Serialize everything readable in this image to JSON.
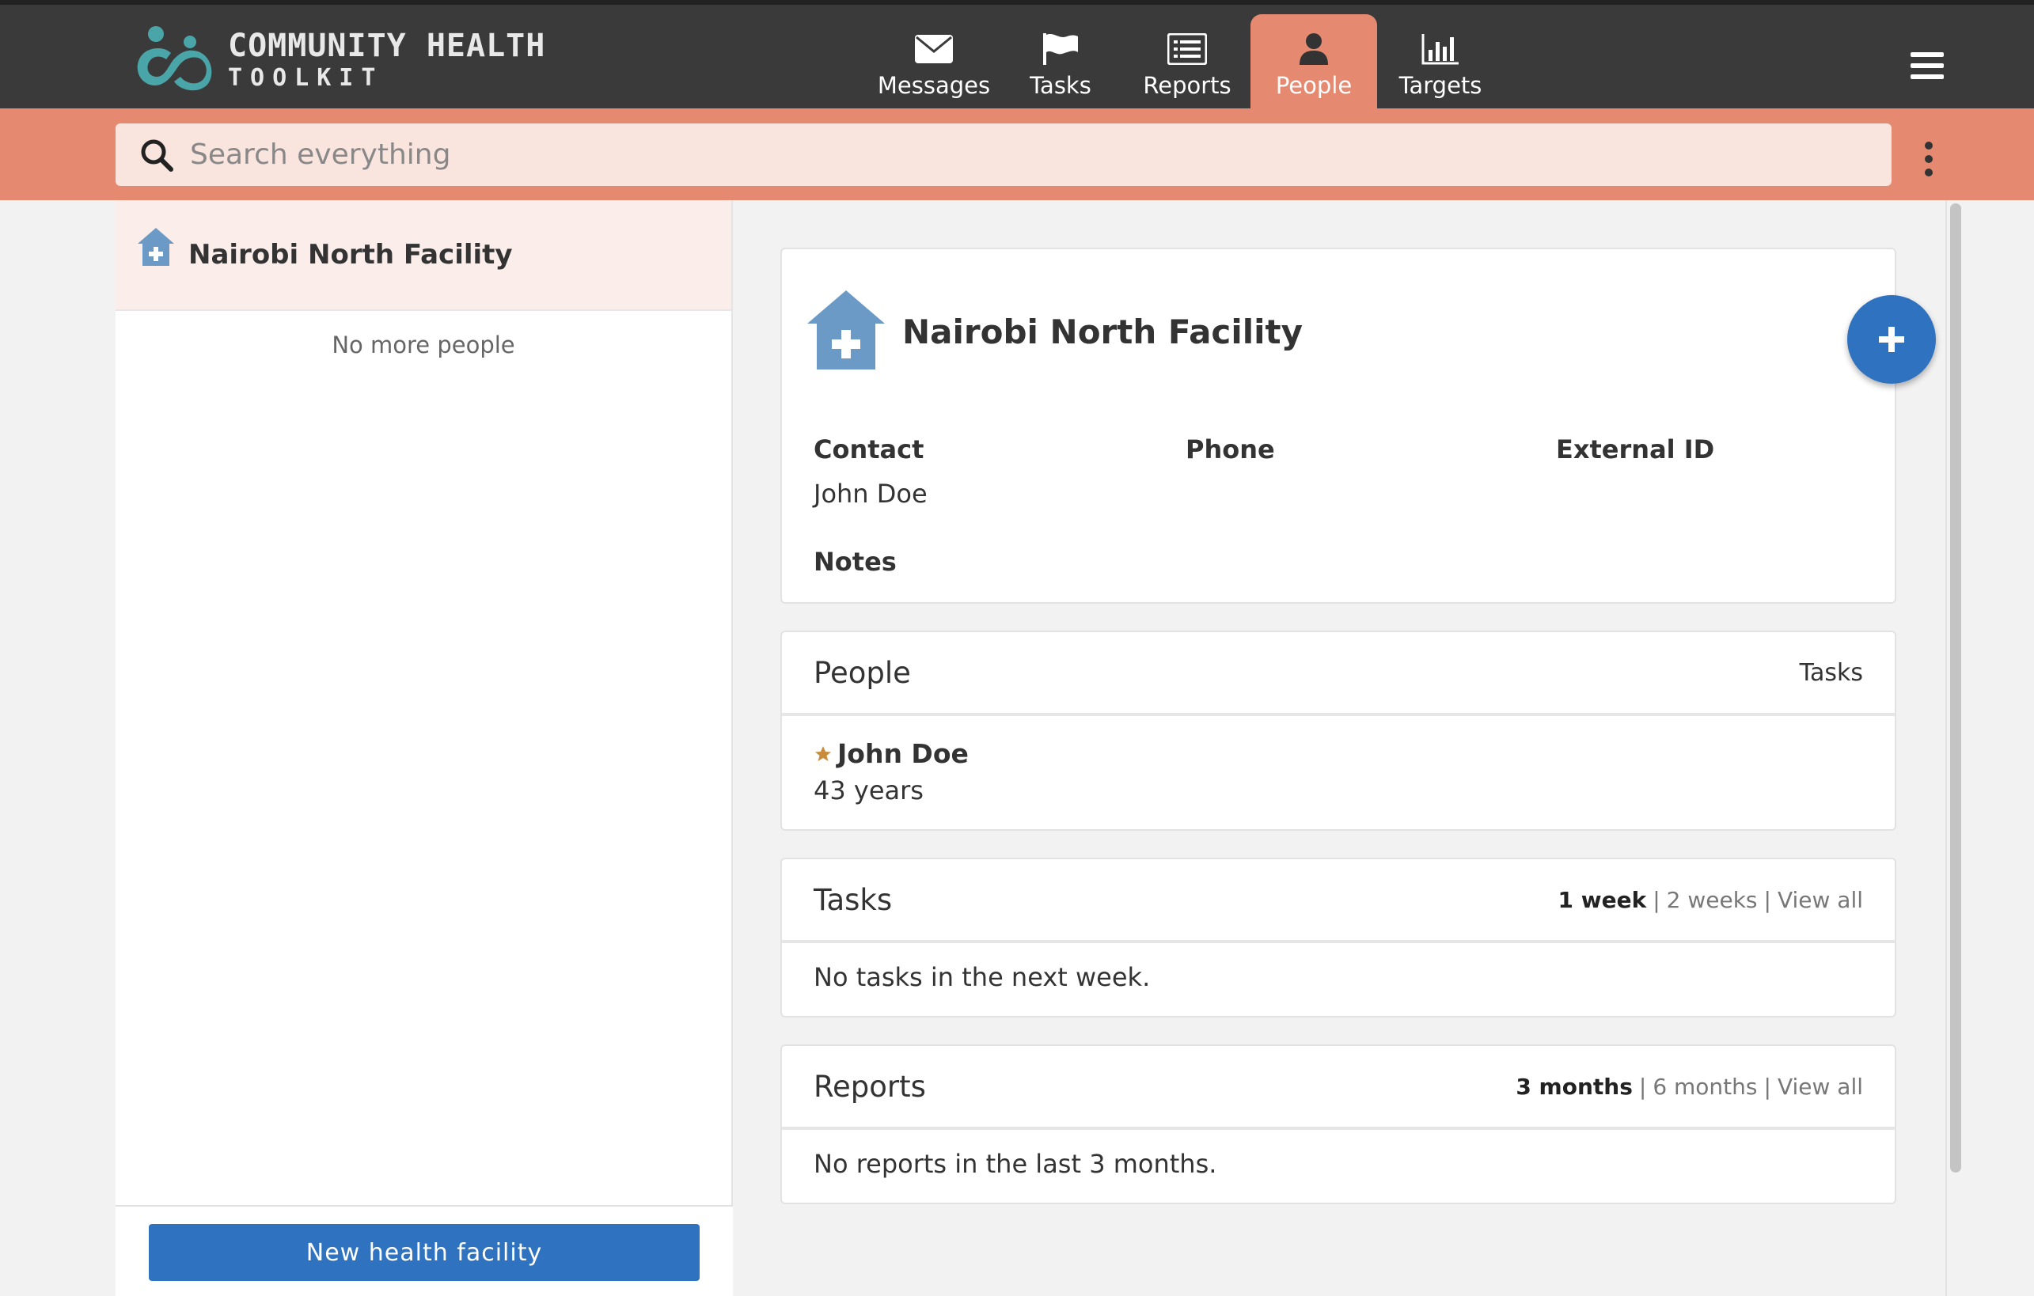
{
  "app": {
    "logo_line1": "COMMUNITY HEALTH",
    "logo_line2": "TOOLKIT"
  },
  "nav": {
    "tabs": [
      {
        "label": "Messages",
        "icon": "envelope-icon"
      },
      {
        "label": "Tasks",
        "icon": "flag-icon"
      },
      {
        "label": "Reports",
        "icon": "list-icon"
      },
      {
        "label": "People",
        "icon": "person-icon",
        "active": true
      },
      {
        "label": "Targets",
        "icon": "bar-chart-icon"
      }
    ]
  },
  "search": {
    "placeholder": "Search everything"
  },
  "left_panel": {
    "selected_item": "Nairobi North Facility",
    "no_more_text": "No more people",
    "new_button": "New health facility"
  },
  "facility": {
    "title": "Nairobi North Facility",
    "contact_label": "Contact",
    "contact_value": "John Doe",
    "phone_label": "Phone",
    "external_id_label": "External ID",
    "notes_label": "Notes"
  },
  "people_section": {
    "title": "People",
    "right_label": "Tasks",
    "person_name": "John Doe",
    "person_age": "43 years"
  },
  "tasks_section": {
    "title": "Tasks",
    "filter_selected": "1 week",
    "filter_2": "2 weeks",
    "filter_3": "View all",
    "empty": "No tasks in the next week."
  },
  "reports_section": {
    "title": "Reports",
    "filter_selected": "3 months",
    "filter_2": "6 months",
    "filter_3": "View all",
    "empty": "No reports in the last 3 months."
  },
  "colors": {
    "accent": "#e58a71",
    "header": "#3a3a3a",
    "primary": "#2f73c0",
    "house": "#6b9ac7",
    "star": "#c98b3c"
  }
}
